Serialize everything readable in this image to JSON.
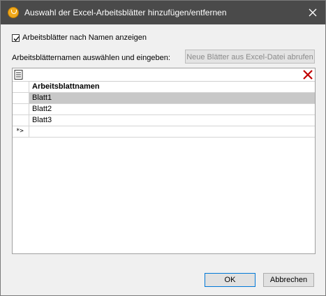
{
  "window": {
    "title": "Auswahl der Excel-Arbeitsblätter hinzufügen/entfernen"
  },
  "options": {
    "show_by_name_label": "Arbeitsblätter nach Namen anzeigen",
    "show_by_name_checked": true
  },
  "sheet_section": {
    "label": "Arbeitsblätternamen auswählen und eingeben:",
    "fetch_button_label": "Neue Blätter aus Excel-Datei abrufen"
  },
  "grid": {
    "column_header": "Arbeitsblattnamen",
    "rows": [
      "Blatt1",
      "Blatt2",
      "Blatt3"
    ],
    "selected_row": "Blatt1",
    "new_row_marker": "*>"
  },
  "footer": {
    "ok_label": "OK",
    "cancel_label": "Abbrechen"
  }
}
